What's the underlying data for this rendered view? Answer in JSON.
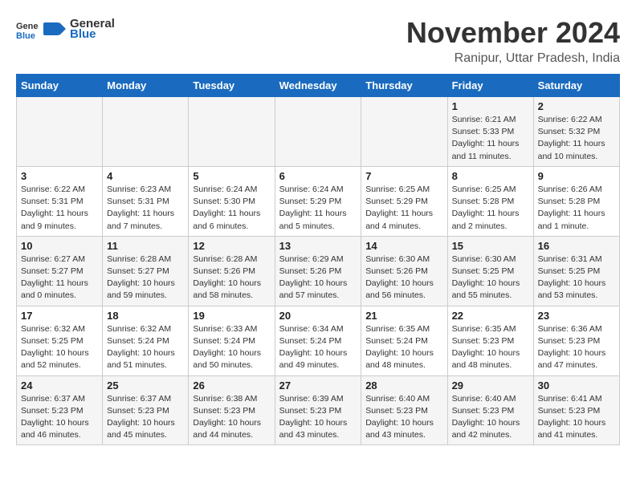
{
  "header": {
    "logo_general": "General",
    "logo_blue": "Blue",
    "month_title": "November 2024",
    "location": "Ranipur, Uttar Pradesh, India"
  },
  "days_of_week": [
    "Sunday",
    "Monday",
    "Tuesday",
    "Wednesday",
    "Thursday",
    "Friday",
    "Saturday"
  ],
  "weeks": [
    [
      {
        "day": "",
        "sunrise": "",
        "sunset": "",
        "daylight": ""
      },
      {
        "day": "",
        "sunrise": "",
        "sunset": "",
        "daylight": ""
      },
      {
        "day": "",
        "sunrise": "",
        "sunset": "",
        "daylight": ""
      },
      {
        "day": "",
        "sunrise": "",
        "sunset": "",
        "daylight": ""
      },
      {
        "day": "",
        "sunrise": "",
        "sunset": "",
        "daylight": ""
      },
      {
        "day": "1",
        "sunrise": "Sunrise: 6:21 AM",
        "sunset": "Sunset: 5:33 PM",
        "daylight": "Daylight: 11 hours and 11 minutes."
      },
      {
        "day": "2",
        "sunrise": "Sunrise: 6:22 AM",
        "sunset": "Sunset: 5:32 PM",
        "daylight": "Daylight: 11 hours and 10 minutes."
      }
    ],
    [
      {
        "day": "3",
        "sunrise": "Sunrise: 6:22 AM",
        "sunset": "Sunset: 5:31 PM",
        "daylight": "Daylight: 11 hours and 9 minutes."
      },
      {
        "day": "4",
        "sunrise": "Sunrise: 6:23 AM",
        "sunset": "Sunset: 5:31 PM",
        "daylight": "Daylight: 11 hours and 7 minutes."
      },
      {
        "day": "5",
        "sunrise": "Sunrise: 6:24 AM",
        "sunset": "Sunset: 5:30 PM",
        "daylight": "Daylight: 11 hours and 6 minutes."
      },
      {
        "day": "6",
        "sunrise": "Sunrise: 6:24 AM",
        "sunset": "Sunset: 5:29 PM",
        "daylight": "Daylight: 11 hours and 5 minutes."
      },
      {
        "day": "7",
        "sunrise": "Sunrise: 6:25 AM",
        "sunset": "Sunset: 5:29 PM",
        "daylight": "Daylight: 11 hours and 4 minutes."
      },
      {
        "day": "8",
        "sunrise": "Sunrise: 6:25 AM",
        "sunset": "Sunset: 5:28 PM",
        "daylight": "Daylight: 11 hours and 2 minutes."
      },
      {
        "day": "9",
        "sunrise": "Sunrise: 6:26 AM",
        "sunset": "Sunset: 5:28 PM",
        "daylight": "Daylight: 11 hours and 1 minute."
      }
    ],
    [
      {
        "day": "10",
        "sunrise": "Sunrise: 6:27 AM",
        "sunset": "Sunset: 5:27 PM",
        "daylight": "Daylight: 11 hours and 0 minutes."
      },
      {
        "day": "11",
        "sunrise": "Sunrise: 6:28 AM",
        "sunset": "Sunset: 5:27 PM",
        "daylight": "Daylight: 10 hours and 59 minutes."
      },
      {
        "day": "12",
        "sunrise": "Sunrise: 6:28 AM",
        "sunset": "Sunset: 5:26 PM",
        "daylight": "Daylight: 10 hours and 58 minutes."
      },
      {
        "day": "13",
        "sunrise": "Sunrise: 6:29 AM",
        "sunset": "Sunset: 5:26 PM",
        "daylight": "Daylight: 10 hours and 57 minutes."
      },
      {
        "day": "14",
        "sunrise": "Sunrise: 6:30 AM",
        "sunset": "Sunset: 5:26 PM",
        "daylight": "Daylight: 10 hours and 56 minutes."
      },
      {
        "day": "15",
        "sunrise": "Sunrise: 6:30 AM",
        "sunset": "Sunset: 5:25 PM",
        "daylight": "Daylight: 10 hours and 55 minutes."
      },
      {
        "day": "16",
        "sunrise": "Sunrise: 6:31 AM",
        "sunset": "Sunset: 5:25 PM",
        "daylight": "Daylight: 10 hours and 53 minutes."
      }
    ],
    [
      {
        "day": "17",
        "sunrise": "Sunrise: 6:32 AM",
        "sunset": "Sunset: 5:25 PM",
        "daylight": "Daylight: 10 hours and 52 minutes."
      },
      {
        "day": "18",
        "sunrise": "Sunrise: 6:32 AM",
        "sunset": "Sunset: 5:24 PM",
        "daylight": "Daylight: 10 hours and 51 minutes."
      },
      {
        "day": "19",
        "sunrise": "Sunrise: 6:33 AM",
        "sunset": "Sunset: 5:24 PM",
        "daylight": "Daylight: 10 hours and 50 minutes."
      },
      {
        "day": "20",
        "sunrise": "Sunrise: 6:34 AM",
        "sunset": "Sunset: 5:24 PM",
        "daylight": "Daylight: 10 hours and 49 minutes."
      },
      {
        "day": "21",
        "sunrise": "Sunrise: 6:35 AM",
        "sunset": "Sunset: 5:24 PM",
        "daylight": "Daylight: 10 hours and 48 minutes."
      },
      {
        "day": "22",
        "sunrise": "Sunrise: 6:35 AM",
        "sunset": "Sunset: 5:23 PM",
        "daylight": "Daylight: 10 hours and 48 minutes."
      },
      {
        "day": "23",
        "sunrise": "Sunrise: 6:36 AM",
        "sunset": "Sunset: 5:23 PM",
        "daylight": "Daylight: 10 hours and 47 minutes."
      }
    ],
    [
      {
        "day": "24",
        "sunrise": "Sunrise: 6:37 AM",
        "sunset": "Sunset: 5:23 PM",
        "daylight": "Daylight: 10 hours and 46 minutes."
      },
      {
        "day": "25",
        "sunrise": "Sunrise: 6:37 AM",
        "sunset": "Sunset: 5:23 PM",
        "daylight": "Daylight: 10 hours and 45 minutes."
      },
      {
        "day": "26",
        "sunrise": "Sunrise: 6:38 AM",
        "sunset": "Sunset: 5:23 PM",
        "daylight": "Daylight: 10 hours and 44 minutes."
      },
      {
        "day": "27",
        "sunrise": "Sunrise: 6:39 AM",
        "sunset": "Sunset: 5:23 PM",
        "daylight": "Daylight: 10 hours and 43 minutes."
      },
      {
        "day": "28",
        "sunrise": "Sunrise: 6:40 AM",
        "sunset": "Sunset: 5:23 PM",
        "daylight": "Daylight: 10 hours and 43 minutes."
      },
      {
        "day": "29",
        "sunrise": "Sunrise: 6:40 AM",
        "sunset": "Sunset: 5:23 PM",
        "daylight": "Daylight: 10 hours and 42 minutes."
      },
      {
        "day": "30",
        "sunrise": "Sunrise: 6:41 AM",
        "sunset": "Sunset: 5:23 PM",
        "daylight": "Daylight: 10 hours and 41 minutes."
      }
    ]
  ]
}
